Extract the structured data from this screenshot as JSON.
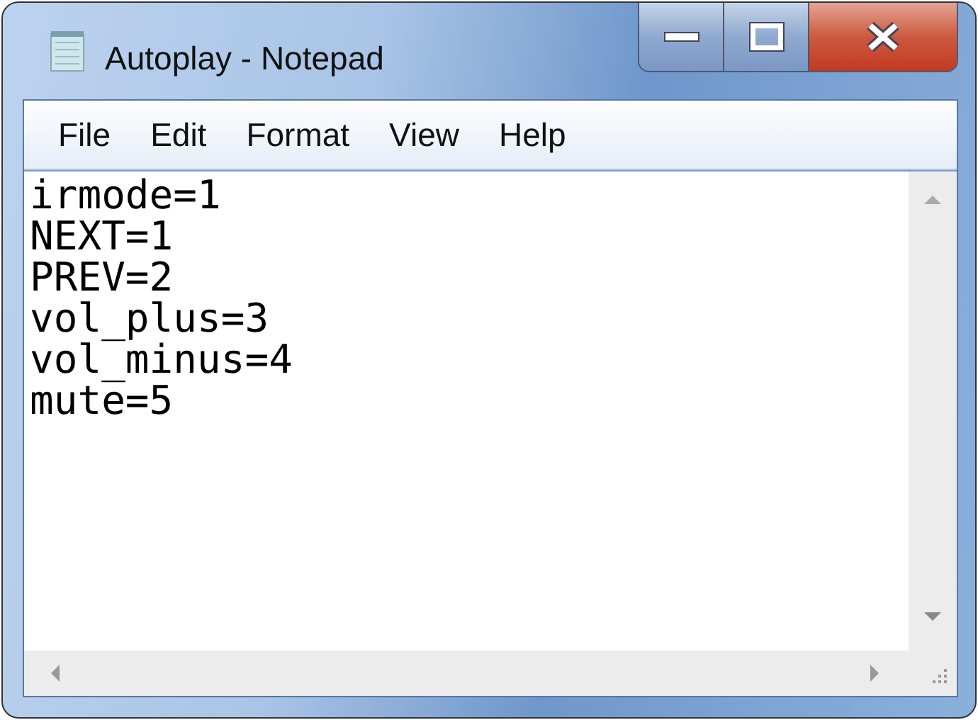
{
  "window": {
    "title": "Autoplay - Notepad"
  },
  "menu": [
    "File",
    "Edit",
    "Format",
    "View",
    "Help"
  ],
  "content": {
    "lines": [
      "irmode=1",
      "NEXT=1",
      "PREV=2",
      "vol_plus=3",
      "vol_minus=4",
      "mute=5"
    ]
  }
}
